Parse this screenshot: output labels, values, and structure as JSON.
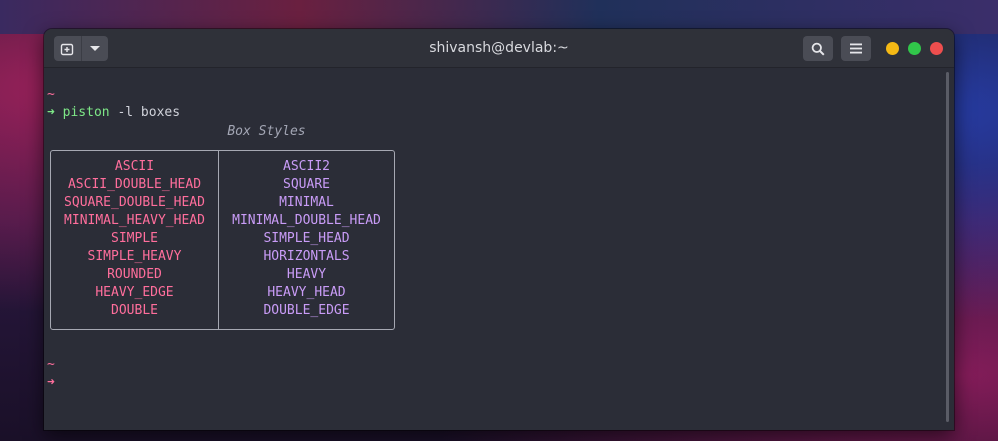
{
  "window": {
    "title": "shivansh@devlab:~"
  },
  "icons": {
    "new_tab": "new-tab-icon",
    "menu_dropdown": "chevron-down-icon",
    "search": "search-icon",
    "hamburger": "hamburger-menu-icon"
  },
  "colors": {
    "minimize": "#f5b915",
    "maximize": "#31c64a",
    "close": "#ee4e4e",
    "prompt_tilde": "#ff6e9c",
    "prompt_ok": "#7ee787",
    "left_column": "#ff6e9c",
    "right_column": "#c99cf7"
  },
  "terminal": {
    "line1_tilde": "~",
    "prompt_arrow": "➜",
    "command": "piston",
    "command_args": " -l boxes",
    "caption": "Box Styles",
    "table": {
      "left": [
        "ASCII",
        "ASCII_DOUBLE_HEAD",
        "SQUARE_DOUBLE_HEAD",
        "MINIMAL_HEAVY_HEAD",
        "SIMPLE",
        "SIMPLE_HEAVY",
        "ROUNDED",
        "HEAVY_EDGE",
        "DOUBLE"
      ],
      "right": [
        "ASCII2",
        "SQUARE",
        "MINIMAL",
        "MINIMAL_DOUBLE_HEAD",
        "SIMPLE_HEAD",
        "HORIZONTALS",
        "HEAVY",
        "HEAVY_HEAD",
        "DOUBLE_EDGE"
      ]
    },
    "line_end_tilde": "~",
    "line_end_arrow": "➜"
  }
}
